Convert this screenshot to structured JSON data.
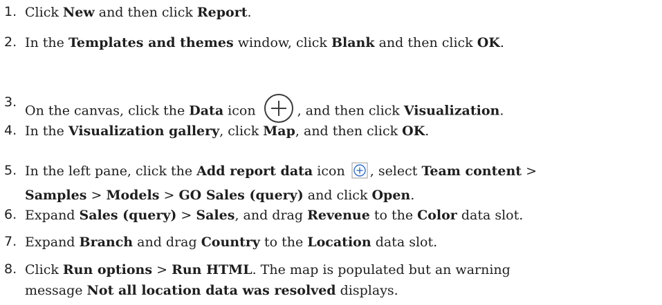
{
  "steps": [
    {
      "n": "1.",
      "p": [
        "Click ",
        {
          "b": "New"
        },
        " and then click ",
        {
          "b": "Report"
        },
        "."
      ]
    },
    {
      "n": "2.",
      "p": [
        "In the ",
        {
          "b": "Templates and themes"
        },
        " window, click ",
        {
          "b": "Blank"
        },
        " and then click ",
        {
          "b": "OK"
        },
        "."
      ]
    },
    {
      "n": "3.",
      "p": [
        "On the canvas, click the ",
        {
          "b": "Data"
        },
        " icon ",
        {
          "icon": "plus-circle-icon"
        },
        ", and then click ",
        {
          "b": "Visualization"
        },
        "."
      ]
    },
    {
      "n": "4.",
      "p": [
        "In the ",
        {
          "b": "Visualization gallery"
        },
        ", click ",
        {
          "b": "Map"
        },
        ", and then click ",
        {
          "b": "OK"
        },
        "."
      ]
    },
    {
      "n": "5.",
      "p": [
        "In the left pane, click the ",
        {
          "b": "Add report data"
        },
        " icon ",
        {
          "icon": "add-data-icon"
        },
        ", select ",
        {
          "b": "Team content"
        },
        " >",
        {
          "br": true
        },
        {
          "b": "Samples"
        },
        " > ",
        {
          "b": "Models"
        },
        " > ",
        {
          "b": "GO Sales (query)"
        },
        " and click ",
        {
          "b": "Open"
        },
        "."
      ]
    },
    {
      "n": "6.",
      "p": [
        "Expand ",
        {
          "b": "Sales (query)"
        },
        " > ",
        {
          "b": "Sales"
        },
        ", and drag ",
        {
          "b": "Revenue"
        },
        " to the ",
        {
          "b": "Color"
        },
        " data slot."
      ]
    },
    {
      "n": "7.",
      "p": [
        "Expand ",
        {
          "b": "Branch"
        },
        " and drag ",
        {
          "b": "Country"
        },
        " to the ",
        {
          "b": "Location"
        },
        " data slot."
      ]
    },
    {
      "n": "8.",
      "p": [
        "Click ",
        {
          "b": "Run options"
        },
        " > ",
        {
          "b": "Run HTML"
        },
        ". The map is populated but an warning",
        {
          "br": true
        },
        "message ",
        {
          "b": "Not all location data was resolved"
        },
        " displays."
      ]
    }
  ]
}
